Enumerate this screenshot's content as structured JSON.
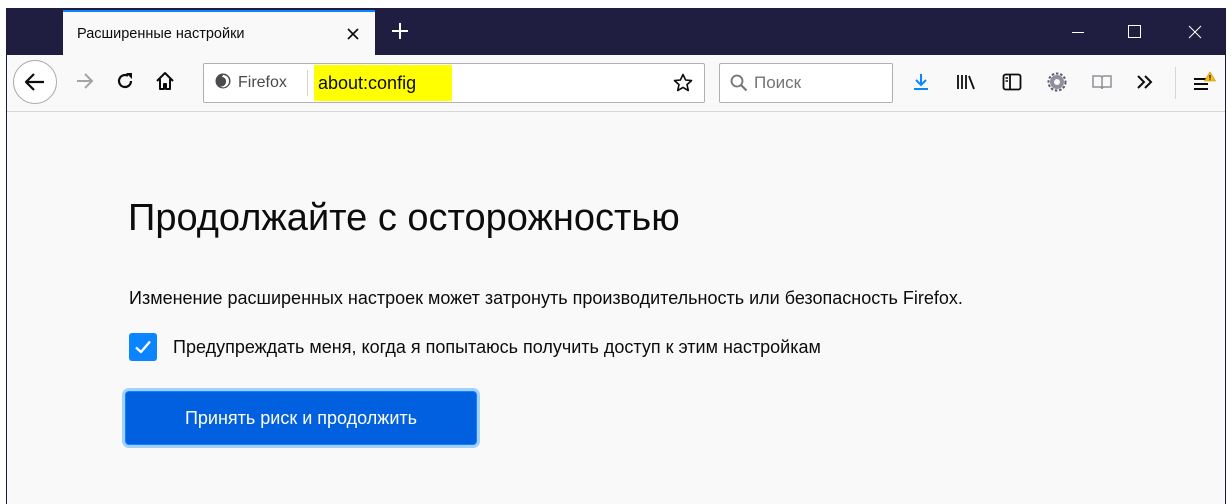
{
  "tab": {
    "title": "Расширенные настройки"
  },
  "urlbar": {
    "identity_label": "Firefox",
    "url": "about:config"
  },
  "search": {
    "placeholder": "Поиск"
  },
  "page": {
    "heading": "Продолжайте с осторожностью",
    "description": "Изменение расширенных настроек может затронуть производительность или безопасность Firefox.",
    "warn_checkbox_label": "Предупреждать меня, когда я попытаюсь получить доступ к этим настройкам",
    "warn_checked": true,
    "accept_button": "Принять риск и продолжить"
  },
  "icons": {
    "back": "back-arrow-icon",
    "forward": "forward-arrow-icon",
    "reload": "reload-icon",
    "home": "home-icon",
    "firefox": "firefox-logo-icon",
    "bookmark": "star-icon",
    "search": "magnifier-icon",
    "downloads": "download-icon",
    "library": "library-icon",
    "sidebar": "sidebar-icon",
    "extension": "gear-extension-icon",
    "reader": "reader-view-icon",
    "overflow": "chevron-double-right-icon",
    "menu": "hamburger-menu-icon",
    "warning": "warning-icon"
  },
  "colors": {
    "titlebar": "#1f1e40",
    "accent": "#0a84ff",
    "primary_button": "#0060df",
    "url_highlight": "#ffff00",
    "page_bg": "#f9f9fa",
    "warning": "#ffbf00"
  }
}
